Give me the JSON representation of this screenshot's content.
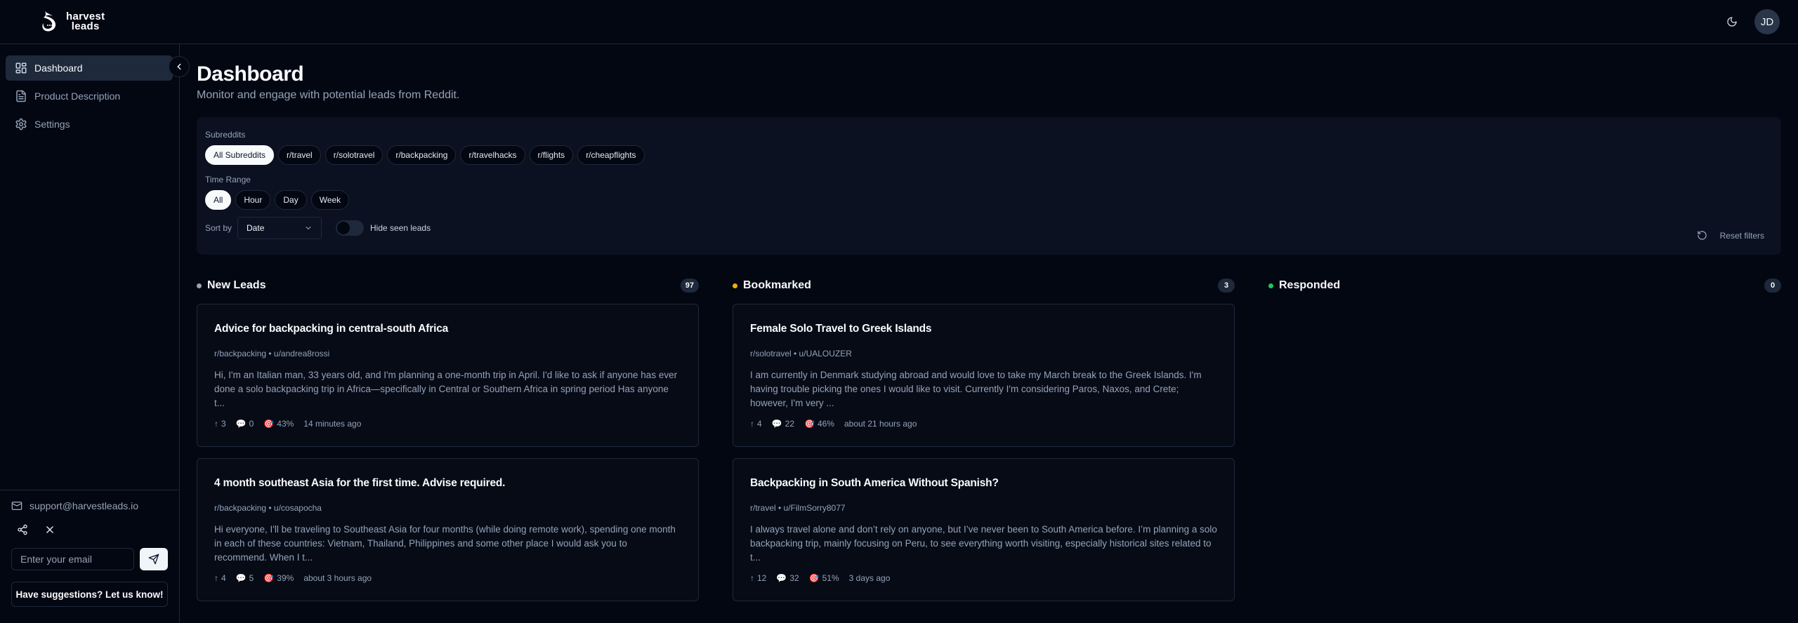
{
  "brand": {
    "line1": "harvest",
    "line2": "leads"
  },
  "header": {
    "theme_icon": "moon-icon",
    "avatar_initials": "JD"
  },
  "sidebar": {
    "items": [
      {
        "label": "Dashboard",
        "icon": "dashboard-icon",
        "active": true
      },
      {
        "label": "Product Description",
        "icon": "document-icon",
        "active": false
      },
      {
        "label": "Settings",
        "icon": "gear-icon",
        "active": false
      }
    ],
    "support_email": "support@harvestleads.io",
    "email_placeholder": "Enter your email",
    "suggestions_label": "Have suggestions? Let us know!"
  },
  "page": {
    "title": "Dashboard",
    "subtitle": "Monitor and engage with potential leads from Reddit."
  },
  "filters": {
    "subreddits_label": "Subreddits",
    "subreddits": [
      "All Subreddits",
      "r/travel",
      "r/solotravel",
      "r/backpacking",
      "r/travelhacks",
      "r/flights",
      "r/cheapflights"
    ],
    "subreddits_selected": "All Subreddits",
    "time_range_label": "Time Range",
    "time_ranges": [
      "All",
      "Hour",
      "Day",
      "Week"
    ],
    "time_range_selected": "All",
    "sort_label": "Sort by",
    "sort_value": "Date",
    "hide_seen_label": "Hide seen leads",
    "hide_seen_enabled": false,
    "reset_label": "Reset filters"
  },
  "colors": {
    "new_leads": "#9ca3af",
    "bookmarked": "#eab308",
    "responded": "#22c55e"
  },
  "columns": [
    {
      "title": "New Leads",
      "count": "97",
      "cards": [
        {
          "title": "Advice for backpacking in central-south Africa",
          "meta": "r/backpacking • u/andrea8rossi",
          "body": "Hi, I'm an Italian man, 33 years old, and I'm planning a one-month trip in April. I'd like to ask if anyone has ever done a solo backpacking trip in Africa—specifically in Central or Southern Africa in spring period Has anyone t...",
          "upvotes": "3",
          "comments": "0",
          "match": "43%",
          "time": "14 minutes ago"
        },
        {
          "title": "4 month southeast Asia for the first time. Advise required.",
          "meta": "r/backpacking • u/cosapocha",
          "body": "Hi everyone, I'll be traveling to Southeast Asia for four months (while doing remote work), spending one month in each of these countries: Vietnam, Thailand, Philippines and some other place I would ask you to recommend. When I t...",
          "upvotes": "4",
          "comments": "5",
          "match": "39%",
          "time": "about 3 hours ago"
        }
      ]
    },
    {
      "title": "Bookmarked",
      "count": "3",
      "cards": [
        {
          "title": "Female Solo Travel to Greek Islands",
          "meta": "r/solotravel • u/UALOUZER",
          "body": "I am currently in Denmark studying abroad and would love to take my March break to the Greek Islands. I'm having trouble picking the ones I would like to visit. Currently I'm considering Paros, Naxos, and Crete; however, I'm very ...",
          "upvotes": "4",
          "comments": "22",
          "match": "46%",
          "time": "about 21 hours ago"
        },
        {
          "title": "Backpacking in South America Without Spanish?",
          "meta": "r/travel • u/FilmSorry8077",
          "body": "I always travel alone and don’t rely on anyone, but I’ve never been to South America before. I’m planning a solo backpacking trip, mainly focusing on Peru, to see everything worth visiting, especially historical sites related to t...",
          "upvotes": "12",
          "comments": "32",
          "match": "51%",
          "time": "3 days ago"
        }
      ]
    },
    {
      "title": "Responded",
      "count": "0",
      "cards": []
    }
  ]
}
